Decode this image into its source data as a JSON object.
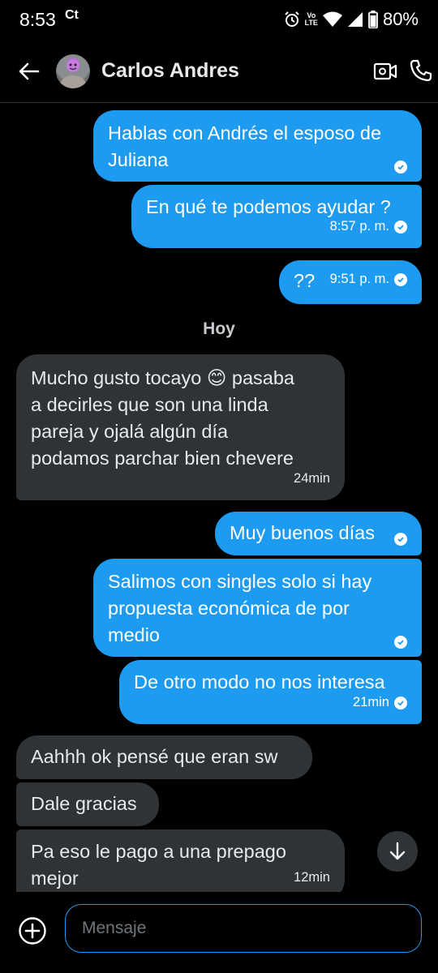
{
  "status_bar": {
    "time": "8:53",
    "carrier_icon": "Ct",
    "volte_top": "Vo",
    "volte_bottom": "LTE",
    "battery": "80%"
  },
  "header": {
    "contact_name": "Carlos Andres",
    "icons": [
      "back-arrow-icon",
      "video-call-icon",
      "phone-icon"
    ]
  },
  "messages": [
    {
      "direction": "out",
      "text_lines": [
        "Hablas con Andrés el esposo de",
        "Juliana"
      ],
      "time": "",
      "read": true
    },
    {
      "direction": "out",
      "text_lines": [
        "En qué te podemos ayudar ?"
      ],
      "time": "8:57 p. m.",
      "read": true
    },
    {
      "direction": "out",
      "text_lines": [
        "??"
      ],
      "time": "9:51 p. m.",
      "read": true
    },
    {
      "direction": "in",
      "text_lines": [
        "Mucho gusto tocayo 😊 pasaba",
        "a decirles que son una linda",
        "pareja y ojalá algún día",
        "podamos parchar bien chevere"
      ],
      "time": "24min"
    },
    {
      "direction": "out",
      "text_lines": [
        "Muy buenos días"
      ],
      "time": "",
      "read": true
    },
    {
      "direction": "out",
      "text_lines": [
        "Salimos con singles solo si hay",
        "propuesta económica de por",
        "medio"
      ],
      "time": "",
      "read": true
    },
    {
      "direction": "out",
      "text_lines": [
        "De otro modo no nos interesa"
      ],
      "time": "21min",
      "read": true
    },
    {
      "direction": "in",
      "text_lines": [
        "Aahhh ok pensé que eran sw"
      ],
      "time": ""
    },
    {
      "direction": "in",
      "text_lines": [
        "Dale gracias"
      ],
      "time": ""
    },
    {
      "direction": "in",
      "text_lines": [
        "Pa eso le pago a una prepago",
        "mejor"
      ],
      "time": "12min"
    }
  ],
  "day_separator": "Hoy",
  "composer": {
    "placeholder": "Mensaje"
  },
  "colors": {
    "outgoing_bubble": "#1d9bf0",
    "incoming_bubble": "#2f3336",
    "background": "#000000"
  }
}
